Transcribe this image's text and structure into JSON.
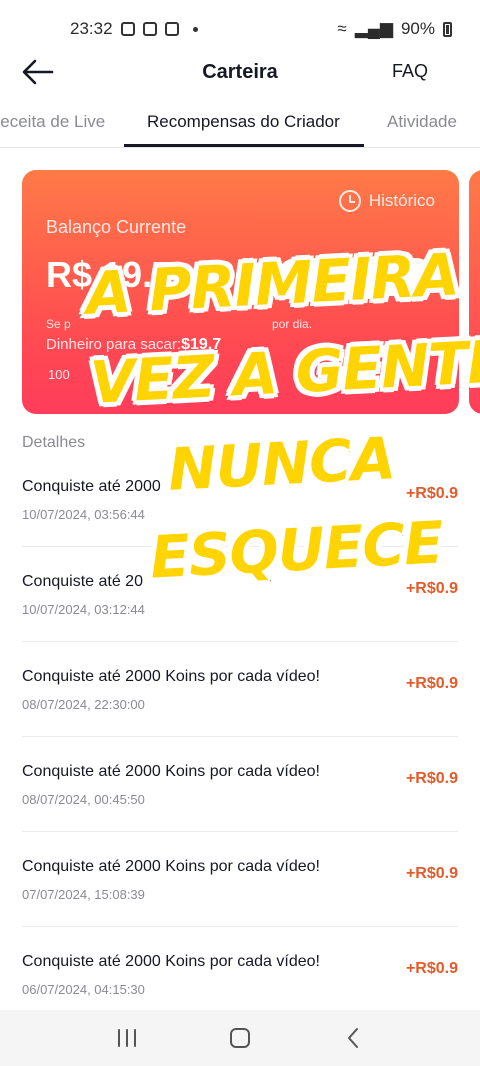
{
  "status": {
    "time": "23:32",
    "battery": "90%"
  },
  "header": {
    "title": "Carteira",
    "faq": "FAQ"
  },
  "tabs": [
    {
      "label": "Receita de Live"
    },
    {
      "label": "Recompensas do Criador"
    },
    {
      "label": "Atividade"
    }
  ],
  "card": {
    "history_label": "Histórico",
    "balance_label": "Balanço Currente",
    "balance_value": "R$ 19.7",
    "note": "Se p",
    "note_suffix": "por dia.",
    "withdrawable_label": "Dinheiro para sacar:",
    "withdrawable_value": "$19.7",
    "small_value": "100"
  },
  "details_label": "Detalhes",
  "items": [
    {
      "title": "Conquiste até 2000",
      "date": "10/07/2024, 03:56:44",
      "amount": "+R$0.9"
    },
    {
      "title": "Conquiste até 20",
      "date": "10/07/2024, 03:12:44",
      "amount": "+R$0.9"
    },
    {
      "title": "Conquiste até 2000 Koins por cada vídeo!",
      "date": "08/07/2024, 22:30:00",
      "amount": "+R$0.9"
    },
    {
      "title": "Conquiste até 2000 Koins por cada vídeo!",
      "date": "08/07/2024, 00:45:50",
      "amount": "+R$0.9"
    },
    {
      "title": "Conquiste até 2000 Koins por cada vídeo!",
      "date": "07/07/2024, 15:08:39",
      "amount": "+R$0.9"
    },
    {
      "title": "Conquiste até 2000 Koins por cada vídeo!",
      "date": "06/07/2024, 04:15:30",
      "amount": "+R$0.9"
    }
  ],
  "caption": {
    "line1": "A PRIMEIRA",
    "line2": "VEZ A GENTE",
    "line3": "NUNCA",
    "line4": "ESQUECE"
  }
}
